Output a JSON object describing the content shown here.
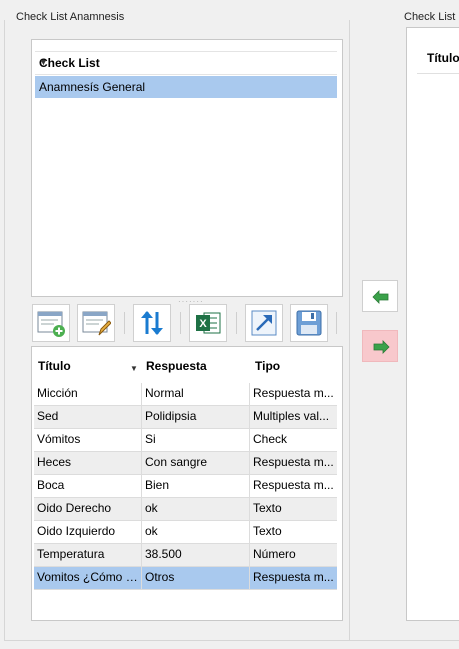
{
  "left_group": {
    "title": "Check List Anamnesis"
  },
  "right_group": {
    "title": "Check List M"
  },
  "checklist": {
    "header": "Check List",
    "dropdown_icon": "chevron-down-icon",
    "items": [
      "Anamnesís General"
    ],
    "selected_index": 0
  },
  "toolbar": {
    "buttons": [
      {
        "name": "add-checklist-button",
        "icon": "form-add-icon"
      },
      {
        "name": "edit-checklist-button",
        "icon": "form-edit-icon"
      },
      {
        "name": "sort-button",
        "icon": "sort-arrows-icon"
      },
      {
        "name": "export-excel-button",
        "icon": "excel-icon"
      },
      {
        "name": "open-button",
        "icon": "expand-arrow-icon"
      },
      {
        "name": "save-button",
        "icon": "floppy-disk-icon"
      }
    ]
  },
  "table": {
    "columns": [
      "Título",
      "Respuesta",
      "Tipo"
    ],
    "rows": [
      {
        "titulo": "Micción",
        "respuesta": "Normal",
        "tipo": "Respuesta m..."
      },
      {
        "titulo": "Sed",
        "respuesta": "Polidipsia",
        "tipo": "Multiples val..."
      },
      {
        "titulo": "Vómitos",
        "respuesta": "Si",
        "tipo": "Check"
      },
      {
        "titulo": "Heces",
        "respuesta": "Con sangre",
        "tipo": "Respuesta m..."
      },
      {
        "titulo": "Boca",
        "respuesta": "Bien",
        "tipo": "Respuesta m..."
      },
      {
        "titulo": "Oido Derecho",
        "respuesta": "ok",
        "tipo": "Texto"
      },
      {
        "titulo": "Oido Izquierdo",
        "respuesta": "ok",
        "tipo": "Texto"
      },
      {
        "titulo": "Temperatura",
        "respuesta": "38.500",
        "tipo": "Número"
      },
      {
        "titulo": "Vomitos ¿Cómo s...",
        "respuesta": "Otros",
        "tipo": "Respuesta m..."
      }
    ],
    "selected_index": 8
  },
  "move": {
    "left_icon": "arrow-left-icon",
    "right_icon": "arrow-right-icon",
    "left_color": "#3aa24a",
    "right_color": "#3aa24a"
  },
  "right_panel": {
    "header": "Título"
  },
  "colors": {
    "selection": "#a9c9ee",
    "accent_red": "#f8c8cc"
  }
}
